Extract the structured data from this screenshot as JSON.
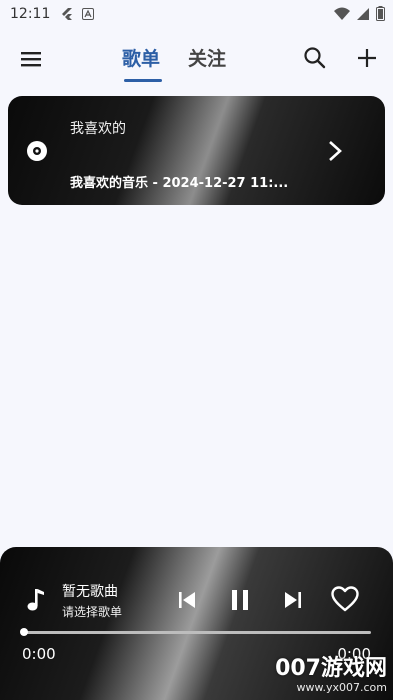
{
  "status_bar": {
    "time": "12:11",
    "left_icons": [
      "flutter-icon",
      "a-badge-icon"
    ],
    "right_icons": [
      "wifi-icon",
      "signal-icon",
      "battery-icon"
    ]
  },
  "app_bar": {
    "tabs": [
      {
        "label": "歌单",
        "active": true
      },
      {
        "label": "关注",
        "active": false
      }
    ],
    "accent_color": "#2d5fa6",
    "icons": [
      "menu-icon",
      "search-icon",
      "add-icon"
    ]
  },
  "playlists": [
    {
      "title": "我喜欢的",
      "subtitle": "我喜欢的音乐 - 2024-12-27 11:...",
      "icon": "disc-icon",
      "trailing_icon": "chevron-right-icon"
    }
  ],
  "player": {
    "song_title": "暂无歌曲",
    "song_subtitle": "请选择歌单",
    "current_time": "0:00",
    "total_time": "0:00",
    "progress": 0,
    "icons": [
      "music-note-icon",
      "skip-previous-icon",
      "pause-icon",
      "skip-next-icon",
      "heart-outline-icon"
    ]
  },
  "watermark": {
    "main": "007游戏网",
    "url": "www.yx007.com"
  }
}
